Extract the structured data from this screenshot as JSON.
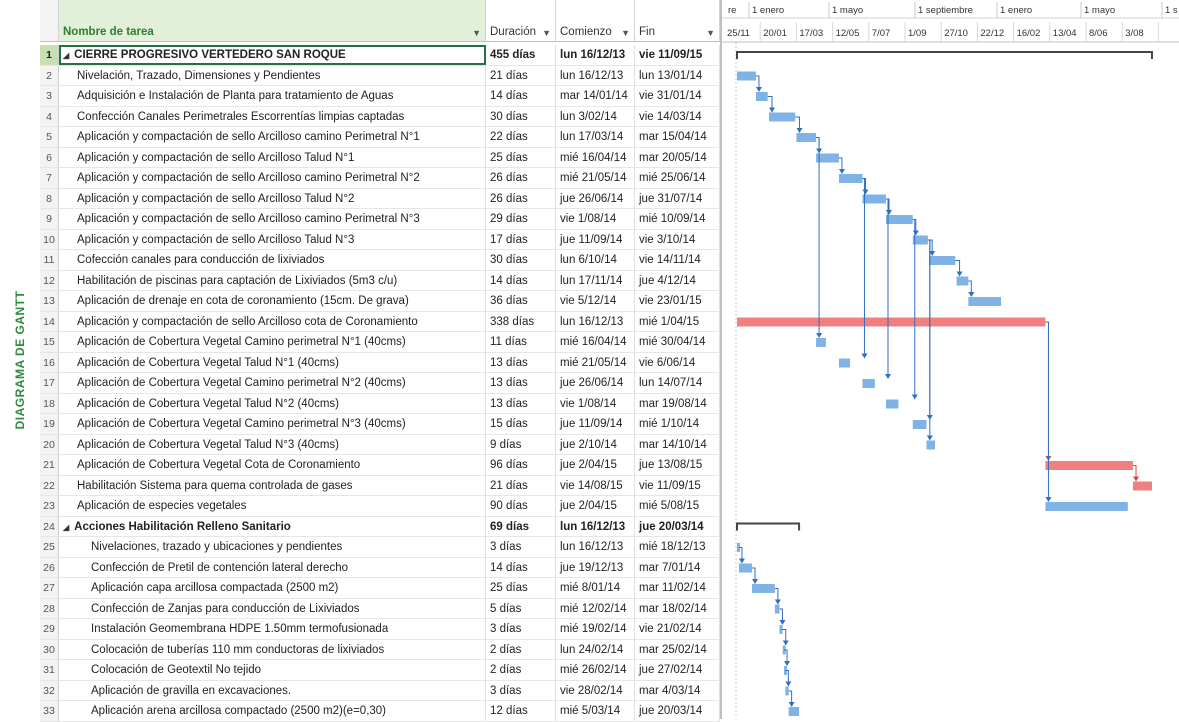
{
  "side_label": "DIAGRAMA DE GANTT",
  "columns": {
    "name": "Nombre de tarea",
    "duration": "Duración",
    "start": "Comienzo",
    "finish": "Fin",
    "sort_icon": "dropdown-arrow-icon"
  },
  "timescale": {
    "top": [
      "re",
      "1 enero",
      "1 mayo",
      "1 septiembre",
      "1 enero",
      "1 mayo",
      "1 s"
    ],
    "bottom": [
      "25/11",
      "20/01",
      "17/03",
      "12/05",
      "7/07",
      "1/09",
      "27/10",
      "22/12",
      "16/02",
      "13/04",
      "8/06",
      "3/08"
    ]
  },
  "colors": {
    "bar_normal": "#7fb3e6",
    "bar_critical": "#f08080",
    "summary_bar": "#444444",
    "link_normal": "#2f6fc4",
    "link_critical": "#d64545",
    "selection": "#217346",
    "side_label": "#2e8b3e"
  },
  "tasks": [
    {
      "id": "1",
      "name": "CIERRE PROGRESIVO VERTEDERO SAN ROQUE",
      "dur": "455 días",
      "start": "lun 16/12/13",
      "fin": "vie 11/09/15",
      "summary": true
    },
    {
      "id": "2",
      "name": "Nivelación, Trazado, Dimensiones y Pendientes",
      "dur": "21 días",
      "start": "lun 16/12/13",
      "fin": "lun 13/01/14"
    },
    {
      "id": "3",
      "name": "Adquisición e Instalación de Planta para tratamiento de Aguas",
      "dur": "14 días",
      "start": "mar 14/01/14",
      "fin": "vie 31/01/14"
    },
    {
      "id": "4",
      "name": "Confección Canales Perimetrales Escorrentías limpias captadas",
      "dur": "30 días",
      "start": "lun 3/02/14",
      "fin": "vie 14/03/14"
    },
    {
      "id": "5",
      "name": "Aplicación y compactación de sello Arcilloso camino Perimetral N°1",
      "dur": "22 días",
      "start": "lun 17/03/14",
      "fin": "mar 15/04/14"
    },
    {
      "id": "6",
      "name": "Aplicación y compactación de sello Arcilloso Talud N°1",
      "dur": "25 días",
      "start": "mié 16/04/14",
      "fin": "mar 20/05/14"
    },
    {
      "id": "7",
      "name": "Aplicación y compactación de sello Arcilloso camino Perimetral N°2",
      "dur": "26 días",
      "start": "mié 21/05/14",
      "fin": "mié 25/06/14"
    },
    {
      "id": "8",
      "name": "Aplicación y compactación de sello Arcilloso Talud N°2",
      "dur": "26 días",
      "start": "jue 26/06/14",
      "fin": "jue 31/07/14"
    },
    {
      "id": "9",
      "name": "Aplicación y compactación de sello Arcilloso camino Perimetral N°3",
      "dur": "29 días",
      "start": "vie 1/08/14",
      "fin": "mié 10/09/14"
    },
    {
      "id": "10",
      "name": "Aplicación y compactación de sello Arcilloso Talud N°3",
      "dur": "17 días",
      "start": "jue 11/09/14",
      "fin": "vie 3/10/14"
    },
    {
      "id": "11",
      "name": "Cofección canales para conducción de lixiviados",
      "dur": "30 días",
      "start": "lun 6/10/14",
      "fin": "vie 14/11/14"
    },
    {
      "id": "12",
      "name": "Habilitación de piscinas para captación de Lixiviados (5m3 c/u)",
      "dur": "14 días",
      "start": "lun 17/11/14",
      "fin": "jue 4/12/14"
    },
    {
      "id": "13",
      "name": "Aplicación de drenaje en cota de coronamiento (15cm. De grava)",
      "dur": "36 días",
      "start": "vie 5/12/14",
      "fin": "vie 23/01/15"
    },
    {
      "id": "14",
      "name": "Aplicación y compactación de sello Arcilloso cota de Coronamiento",
      "dur": "338 días",
      "start": "lun 16/12/13",
      "fin": "mié 1/04/15"
    },
    {
      "id": "15",
      "name": "Aplicación de Cobertura Vegetal Camino perimetral N°1 (40cms)",
      "dur": "11 días",
      "start": "mié 16/04/14",
      "fin": "mié 30/04/14"
    },
    {
      "id": "16",
      "name": "Aplicación de Cobertura Vegetal Talud N°1 (40cms)",
      "dur": "13 días",
      "start": "mié 21/05/14",
      "fin": "vie 6/06/14"
    },
    {
      "id": "17",
      "name": "Aplicación de Cobertura Vegetal Camino perimetral N°2 (40cms)",
      "dur": "13 días",
      "start": "jue 26/06/14",
      "fin": "lun 14/07/14"
    },
    {
      "id": "18",
      "name": "Aplicación de Cobertura Vegetal Talud N°2 (40cms)",
      "dur": "13 días",
      "start": "vie 1/08/14",
      "fin": "mar 19/08/14"
    },
    {
      "id": "19",
      "name": "Aplicación de Cobertura Vegetal Camino perimetral N°3 (40cms)",
      "dur": "15 días",
      "start": "jue 11/09/14",
      "fin": "mié 1/10/14"
    },
    {
      "id": "20",
      "name": "Aplicación de Cobertura Vegetal Talud N°3 (40cms)",
      "dur": "9 días",
      "start": "jue 2/10/14",
      "fin": "mar 14/10/14"
    },
    {
      "id": "21",
      "name": "Aplicación de Cobertura Vegetal Cota de Coronamiento",
      "dur": "96 días",
      "start": "jue 2/04/15",
      "fin": "jue 13/08/15"
    },
    {
      "id": "22",
      "name": "Habilitación Sistema para quema controlada de gases",
      "dur": "21 días",
      "start": "vie 14/08/15",
      "fin": "vie 11/09/15"
    },
    {
      "id": "23",
      "name": "Aplicación de especies vegetales",
      "dur": "90 días",
      "start": "jue 2/04/15",
      "fin": "mié 5/08/15"
    },
    {
      "id": "24",
      "name": "Acciones Habilitación Relleno Sanitario",
      "dur": "69 días",
      "start": "lun 16/12/13",
      "fin": "jue 20/03/14",
      "summary": true
    },
    {
      "id": "25",
      "name": "Nivelaciones, trazado y ubicaciones y pendientes",
      "dur": "3 días",
      "start": "lun 16/12/13",
      "fin": "mié 18/12/13"
    },
    {
      "id": "26",
      "name": "Confección de Pretil de contención lateral derecho",
      "dur": "14 días",
      "start": "jue 19/12/13",
      "fin": "mar 7/01/14"
    },
    {
      "id": "27",
      "name": "Aplicación capa arcillosa compactada (2500 m2)",
      "dur": "25 días",
      "start": "mié 8/01/14",
      "fin": "mar 11/02/14"
    },
    {
      "id": "28",
      "name": "Confección de Zanjas para conducción de Lixiviados",
      "dur": "5 días",
      "start": "mié 12/02/14",
      "fin": "mar 18/02/14"
    },
    {
      "id": "29",
      "name": "Instalación Geomembrana HDPE 1.50mm termofusionada",
      "dur": "3 días",
      "start": "mié 19/02/14",
      "fin": "vie 21/02/14"
    },
    {
      "id": "30",
      "name": "Colocación de tuberías 110 mm conductoras de lixiviados",
      "dur": "2 días",
      "start": "lun 24/02/14",
      "fin": "mar 25/02/14"
    },
    {
      "id": "31",
      "name": "Colocación de Geotextil No tejido",
      "dur": "2 días",
      "start": "mié 26/02/14",
      "fin": "jue 27/02/14"
    },
    {
      "id": "32",
      "name": "Aplicación de gravilla en excavaciones.",
      "dur": "3 días",
      "start": "vie 28/02/14",
      "fin": "mar 4/03/14"
    },
    {
      "id": "33",
      "name": "Aplicación arena arcillosa compactado (2500 m2)(e=0,30)",
      "dur": "12 días",
      "start": "mié 5/03/14",
      "fin": "jue 20/03/14"
    }
  ]
}
